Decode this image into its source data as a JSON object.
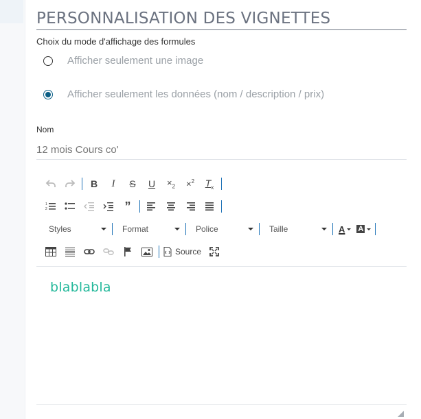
{
  "section": {
    "title": "PERSONNALISATION DES VIGNETTES"
  },
  "display_mode": {
    "label": "Choix du mode d'affichage des formules",
    "options": [
      {
        "label": "Afficher seulement une image",
        "checked": false
      },
      {
        "label": "Afficher seulement les données (nom / description / prix)",
        "checked": true
      }
    ]
  },
  "name_field": {
    "label": "Nom",
    "value": "12 mois Cours co'"
  },
  "editor": {
    "toolbar": {
      "styles_label": "Styles",
      "format_label": "Format",
      "font_label": "Police",
      "size_label": "Taille",
      "source_label": "Source",
      "text_color_glyph": "A",
      "bg_color_glyph": "A"
    },
    "content": "blablabla",
    "colors": {
      "accent_separator": "#1f73b7",
      "content_text": "#23b89a",
      "radio_checked": "#0b5f86"
    }
  }
}
